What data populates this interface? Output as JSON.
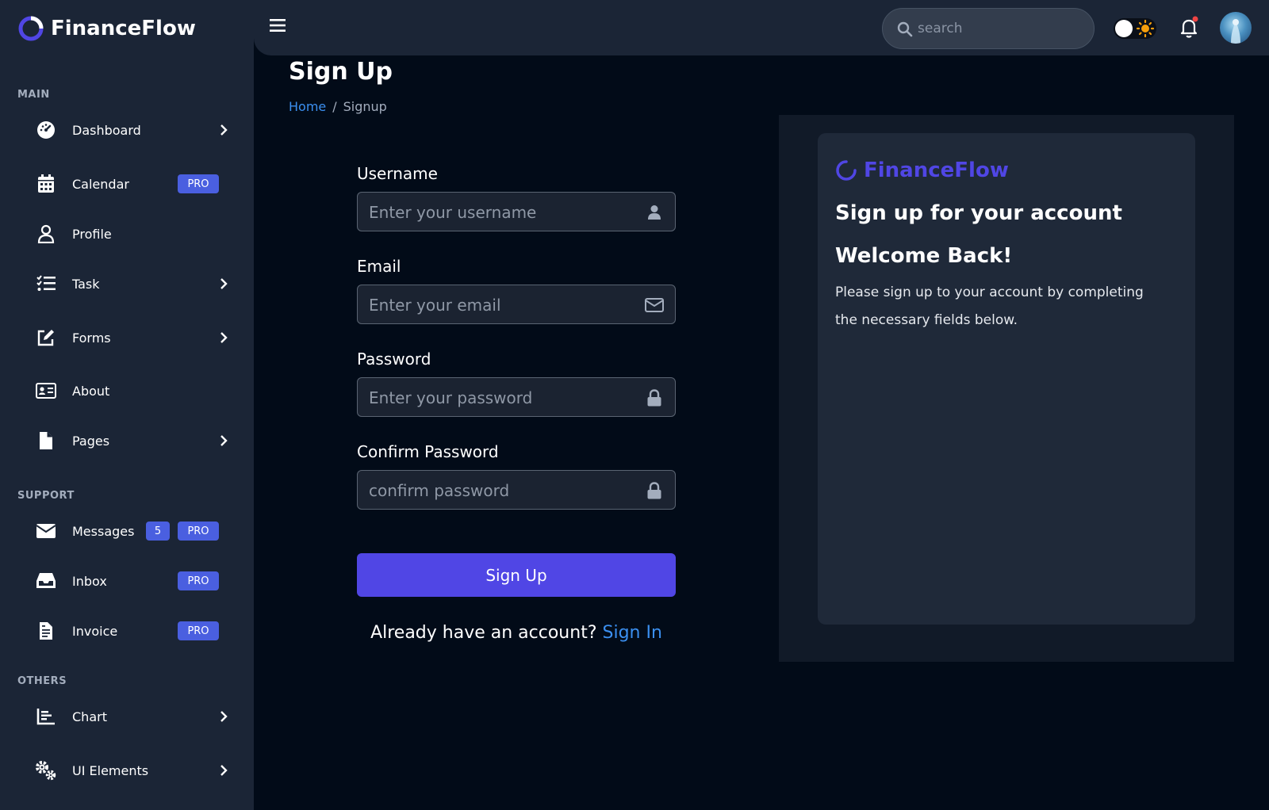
{
  "app": {
    "name": "FinanceFlow",
    "accent_color": "#5046e5",
    "link_color": "#3b8ff0"
  },
  "sidebar": {
    "sections": {
      "main": "MAIN",
      "support": "SUPPORT",
      "others": "OTHERS"
    },
    "items": [
      {
        "label": "Dashboard",
        "icon": "gauge-icon",
        "has_chevron": true
      },
      {
        "label": "Calendar",
        "icon": "calendar-icon",
        "badge": "PRO"
      },
      {
        "label": "Profile",
        "icon": "user-icon"
      },
      {
        "label": "Task",
        "icon": "task-list-icon",
        "has_chevron": true
      },
      {
        "label": "Forms",
        "icon": "edit-icon",
        "has_chevron": true
      },
      {
        "label": "About",
        "icon": "id-card-icon"
      },
      {
        "label": "Pages",
        "icon": "file-icon",
        "has_chevron": true
      },
      {
        "label": "Messages",
        "icon": "envelope-icon",
        "count": "5",
        "badge": "PRO"
      },
      {
        "label": "Inbox",
        "icon": "inbox-icon",
        "badge": "PRO"
      },
      {
        "label": "Invoice",
        "icon": "invoice-icon",
        "badge": "PRO"
      },
      {
        "label": "Chart",
        "icon": "bar-chart-icon",
        "has_chevron": true
      },
      {
        "label": "UI Elements",
        "icon": "gears-icon",
        "has_chevron": true
      }
    ]
  },
  "header": {
    "search_placeholder": "search"
  },
  "main": {
    "title": "Sign Up",
    "breadcrumb": {
      "home": "Home",
      "separator": "/",
      "current": "Signup"
    },
    "form": {
      "username_label": "Username",
      "username_placeholder": "Enter your username",
      "email_label": "Email",
      "email_placeholder": "Enter your email",
      "password_label": "Password",
      "password_placeholder": "Enter your password",
      "confirm_label": "Confirm Password",
      "confirm_placeholder": "confirm password",
      "submit_label": "Sign Up",
      "already_text": "Already have an account?",
      "signin_link": "Sign In"
    }
  },
  "panel": {
    "brand": "FinanceFlow",
    "heading": "Sign up for your account",
    "subheading": "Welcome Back!",
    "description": "Please sign up to your account by completing the necessary fields below."
  }
}
